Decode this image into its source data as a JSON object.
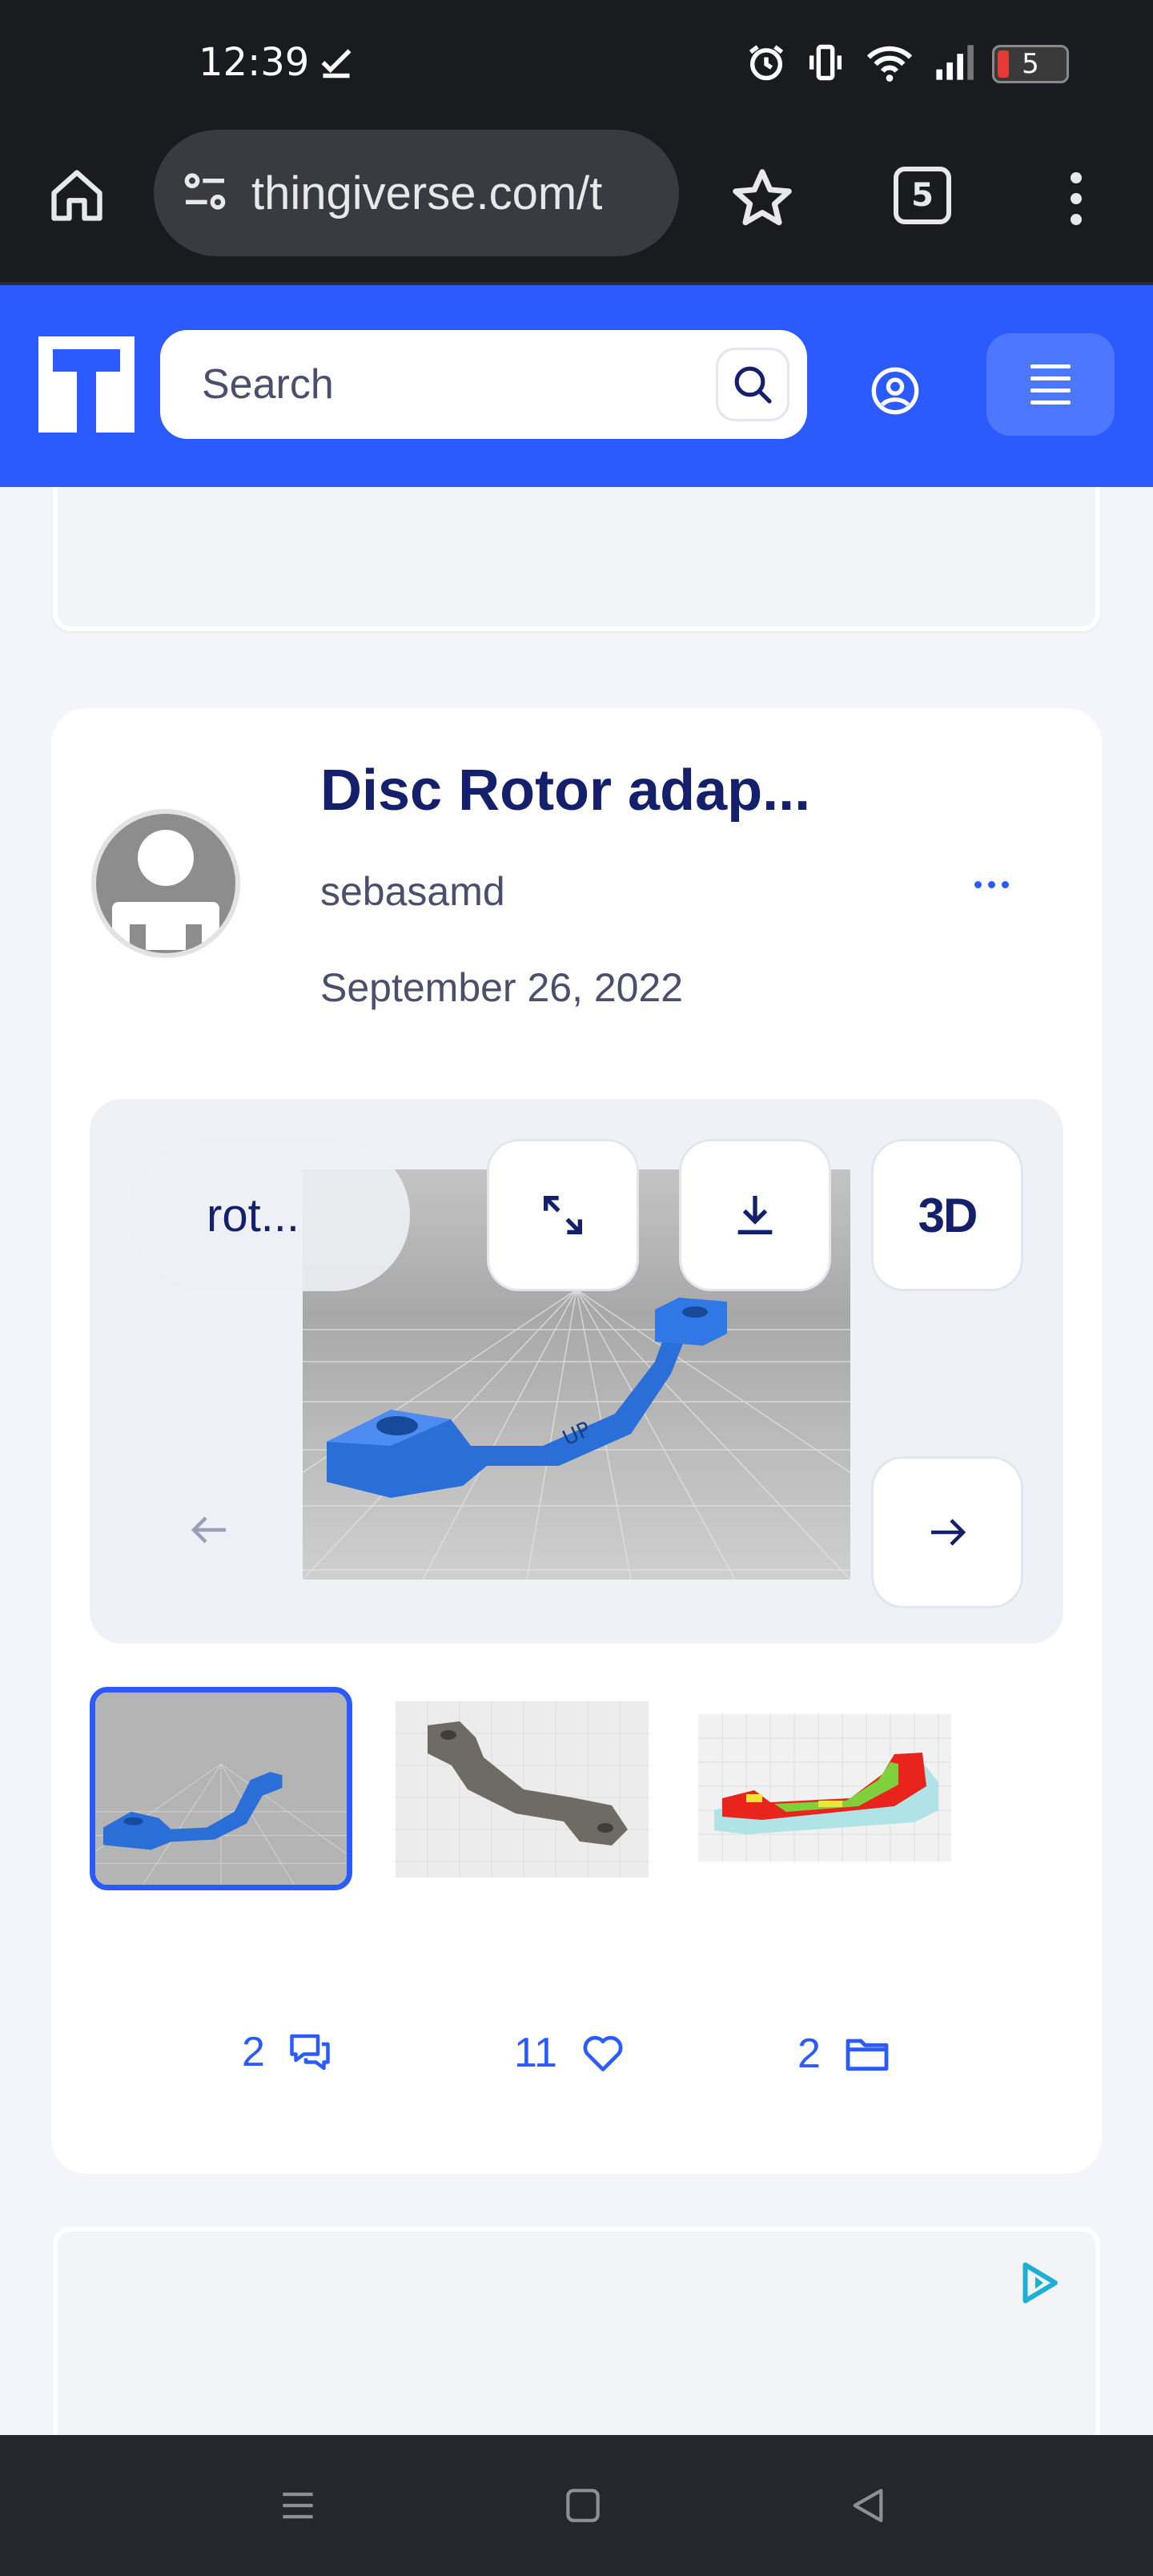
{
  "status_bar": {
    "time": "12:39",
    "battery": "5",
    "icons": [
      "check-icon",
      "alarm-icon",
      "vibrate-icon",
      "wifi-icon",
      "signal-icon",
      "battery-icon"
    ]
  },
  "browser": {
    "url": "thingiverse.com/t",
    "tab_count": "5"
  },
  "site_header": {
    "search_placeholder": "Search",
    "brand_color": "#2b5bff"
  },
  "thing_card": {
    "title": "Disc Rotor adap...",
    "author": "sebasamd",
    "date": "September 26, 2022",
    "gallery": {
      "file_label": "rot...",
      "three_d_label": "3D"
    },
    "thumbnails": [
      "blue-rotor-adapter",
      "gray-rotor-adapter",
      "sliced-rotor-adapter"
    ],
    "stats": {
      "comments": "2",
      "likes": "11",
      "collections": "2"
    }
  }
}
